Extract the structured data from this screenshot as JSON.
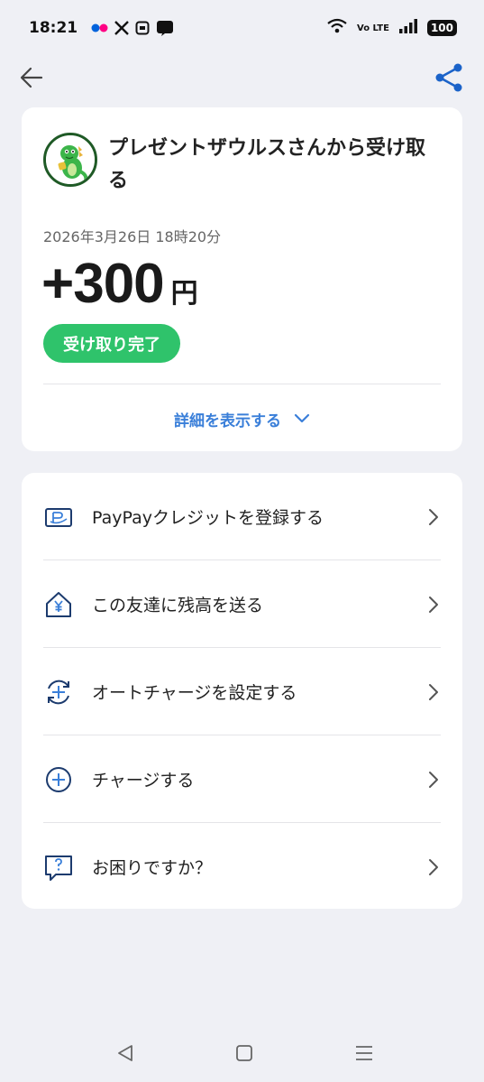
{
  "status_bar": {
    "time": "18:21",
    "notification_icons": [
      "flickr-icon",
      "x-icon",
      "app-icon",
      "line-icon"
    ],
    "network": "Vo LTE",
    "battery": "100"
  },
  "top_bar": {
    "back_icon": "arrow-left-icon",
    "share_icon": "share-icon"
  },
  "transaction": {
    "title": "プレゼントザウルスさんから受け取る",
    "datetime": "2026年3月26日 18時20分",
    "amount": "+300",
    "unit": "円",
    "status": "受け取り完了",
    "details_link": "詳細を表示する"
  },
  "menu": [
    {
      "label": "PayPayクレジットを登録する",
      "icon": "paypay-card-icon"
    },
    {
      "label": "この友達に残高を送る",
      "icon": "send-money-icon"
    },
    {
      "label": "オートチャージを設定する",
      "icon": "auto-charge-icon"
    },
    {
      "label": "チャージする",
      "icon": "charge-icon"
    },
    {
      "label": "お困りですか？",
      "icon": "help-icon"
    }
  ],
  "nav_bar": {
    "back": "nav-back-icon",
    "home": "nav-home-icon",
    "recents": "nav-recents-icon"
  },
  "colors": {
    "accent_blue": "#3a7fd9",
    "status_green": "#2fc36b",
    "icon_navy": "#1c3b6e",
    "background": "#eff0f5"
  }
}
